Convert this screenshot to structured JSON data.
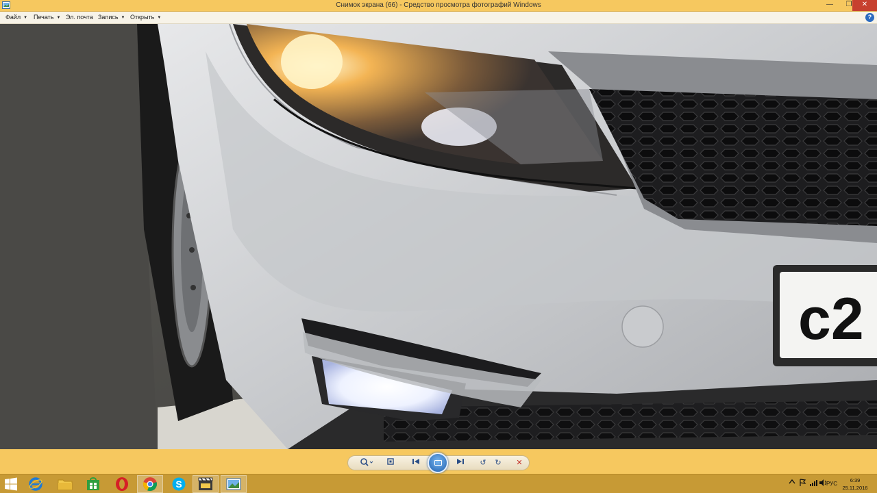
{
  "window": {
    "title": "Снимок экрана (66) - Средство просмотра фотографий Windows",
    "minimize_glyph": "—",
    "maximize_glyph": "❐",
    "close_glyph": "✕"
  },
  "menu": {
    "items": [
      {
        "label": "Файл",
        "has_arrow": true
      },
      {
        "label": "Печать",
        "has_arrow": true
      },
      {
        "label": "Эл. почта",
        "has_arrow": false
      },
      {
        "label": "Запись",
        "has_arrow": true
      },
      {
        "label": "Открыть",
        "has_arrow": true
      }
    ],
    "arrow_glyph": "▼",
    "help_glyph": "?"
  },
  "photo": {
    "plate_text": "c2"
  },
  "toolbar": {
    "zoom_glyph": "🔍",
    "fit_glyph": "⛶",
    "prev_glyph": "⏮",
    "next_glyph": "⏭",
    "rotate_ccw_glyph": "↺",
    "rotate_cw_glyph": "↻",
    "delete_glyph": "✕"
  },
  "taskbar": {
    "apps": [
      "internet-explorer",
      "file-explorer",
      "store",
      "opera",
      "chrome",
      "skype",
      "movie-maker",
      "photo-viewer"
    ],
    "language": "РУС",
    "time": "6:39",
    "date": "25.11.2016"
  },
  "colors": {
    "titlebar": "#f6c85f",
    "taskbar": "#c79a35",
    "close": "#c7402f"
  }
}
